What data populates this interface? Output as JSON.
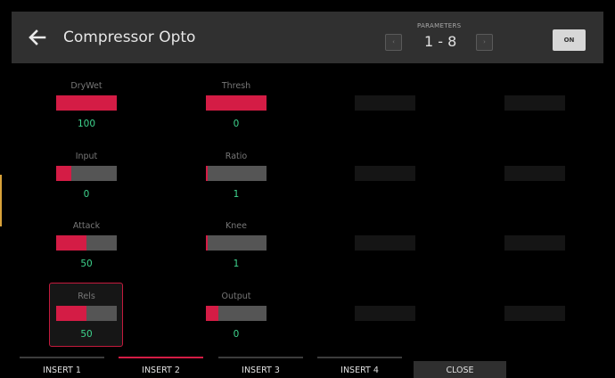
{
  "header": {
    "title": "Compressor Opto",
    "params_label": "PARAMETERS",
    "params_range": "1 - 8",
    "prev_label": "‹",
    "next_label": "›",
    "on_label": "ON"
  },
  "params": [
    {
      "label": "DryWet",
      "value": "100",
      "level": 1.0
    },
    {
      "label": "Thresh",
      "value": "0",
      "level": 1.0
    },
    {
      "label": "Input",
      "value": "0",
      "level": 0.25
    },
    {
      "label": "Ratio",
      "value": "1",
      "level": 0.02
    },
    {
      "label": "Attack",
      "value": "50",
      "level": 0.5
    },
    {
      "label": "Knee",
      "value": "1",
      "level": 0.02
    },
    {
      "label": "Rels",
      "value": "50",
      "level": 0.5
    },
    {
      "label": "Output",
      "value": "0",
      "level": 0.2
    }
  ],
  "tabs": [
    {
      "label": "INSERT 1"
    },
    {
      "label": "INSERT 2"
    },
    {
      "label": "INSERT 3"
    },
    {
      "label": "INSERT 4"
    }
  ],
  "close_label": "CLOSE",
  "colors": {
    "accent": "#d41c45",
    "value": "#3ed48d",
    "header": "#303030"
  }
}
